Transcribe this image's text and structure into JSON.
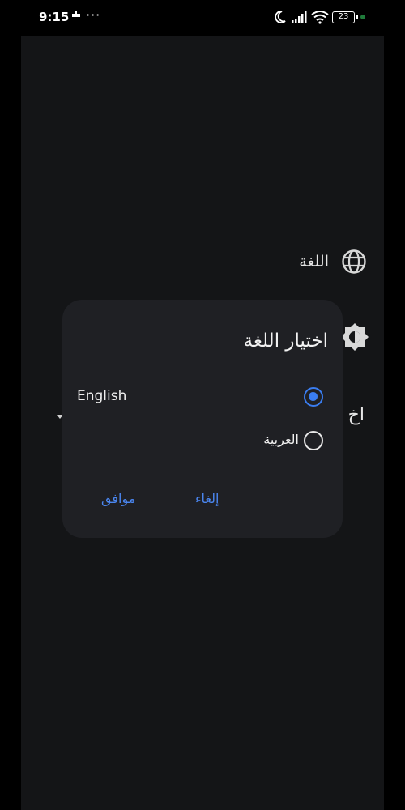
{
  "status_bar": {
    "time": "9:15",
    "notification_icon": "app-notification-icon",
    "more": "···",
    "battery": "23"
  },
  "settings": {
    "language_label": "اللغة",
    "theme_icon": "theme-brightness-icon",
    "partial_label": "اخ"
  },
  "dialog": {
    "title": "اختيار اللغة",
    "options": [
      {
        "label": "English",
        "selected": true
      },
      {
        "label": "العربية",
        "selected": false
      }
    ],
    "ok_label": "موافق",
    "cancel_label": "إلغاء"
  },
  "colors": {
    "accent": "#3a7df0",
    "dialog_bg": "#1f2024",
    "panel_bg": "#141517"
  }
}
